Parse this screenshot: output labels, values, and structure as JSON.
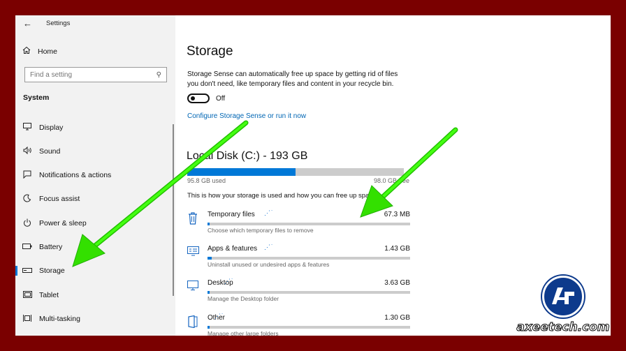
{
  "window": {
    "title": "Settings"
  },
  "sidebar": {
    "home_label": "Home",
    "search_placeholder": "Find a setting",
    "section_title": "System",
    "items": [
      {
        "label": "Display",
        "icon": "display-icon"
      },
      {
        "label": "Sound",
        "icon": "sound-icon"
      },
      {
        "label": "Notifications & actions",
        "icon": "notifications-icon"
      },
      {
        "label": "Focus assist",
        "icon": "focus-assist-icon"
      },
      {
        "label": "Power & sleep",
        "icon": "power-icon"
      },
      {
        "label": "Battery",
        "icon": "battery-icon"
      },
      {
        "label": "Storage",
        "icon": "storage-icon",
        "active": true
      },
      {
        "label": "Tablet",
        "icon": "tablet-icon"
      },
      {
        "label": "Multi-tasking",
        "icon": "multitasking-icon"
      }
    ]
  },
  "main": {
    "title": "Storage",
    "description": "Storage Sense can automatically free up space by getting rid of files you don't need, like temporary files and content in your recycle bin.",
    "toggle_label": "Off",
    "configure_link": "Configure Storage Sense or run it now",
    "disk": {
      "title": "Local Disk (C:) - 193 GB",
      "used": "95.8 GB used",
      "free": "98.0 GB free",
      "used_fraction": 0.5,
      "howto": "This is how your storage is used and how you can free up space."
    },
    "categories": [
      {
        "name": "Temporary files",
        "size": "67.3 MB",
        "sub": "Choose which temporary files to remove",
        "icon": "trash-icon",
        "fraction": 0.0
      },
      {
        "name": "Apps & features",
        "size": "1.43 GB",
        "sub": "Uninstall unused or undesired apps & features",
        "icon": "apps-icon",
        "fraction": 0.02
      },
      {
        "name": "Desktop",
        "size": "3.63 GB",
        "sub": "Manage the Desktop folder",
        "icon": "desktop-icon",
        "fraction": 0.0
      },
      {
        "name": "Other",
        "size": "1.30 GB",
        "sub": "Manage other large folders",
        "icon": "other-folder-icon",
        "fraction": 0.0
      }
    ]
  },
  "watermark": {
    "text": "axeetech.com"
  },
  "colors": {
    "accent": "#0078d7",
    "arrow": "#33e000",
    "border": "#7a0000"
  }
}
